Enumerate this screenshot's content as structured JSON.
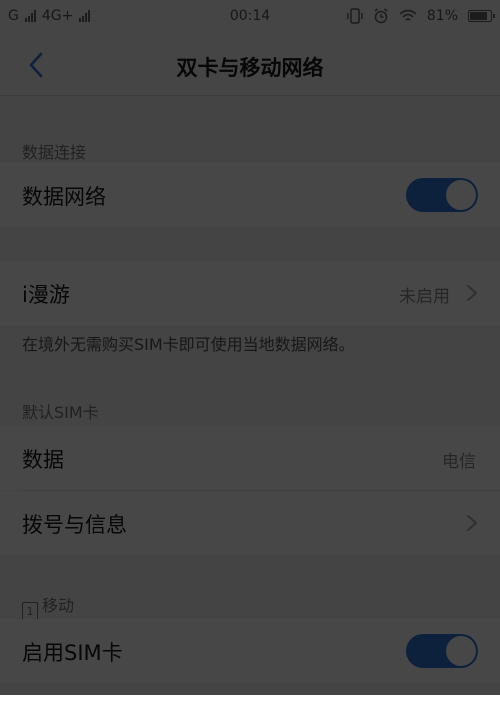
{
  "status_bar": {
    "carrier1": "G",
    "carrier2": "4G+",
    "time": "00:14",
    "battery_pct": "81%",
    "battery_level": 0.81
  },
  "nav": {
    "title": "双卡与移动网络"
  },
  "data_connection": {
    "section_label": "数据连接",
    "mobile_data": {
      "label": "数据网络",
      "enabled": true
    }
  },
  "iroaming": {
    "label": "i漫游",
    "value": "未启用",
    "description": "在境外无需购买SIM卡即可使用当地数据网络。"
  },
  "default_sim": {
    "section_label": "默认SIM卡",
    "data": {
      "label": "数据",
      "value": "电信"
    },
    "call_sms": {
      "label": "拨号与信息"
    }
  },
  "sim1": {
    "slot": "1",
    "section_label": "移动",
    "enable": {
      "label": "启用SIM卡",
      "enabled": true
    }
  },
  "colors": {
    "accent": "#2f73d8",
    "overlay": "rgba(0,0,0,0.72)"
  }
}
